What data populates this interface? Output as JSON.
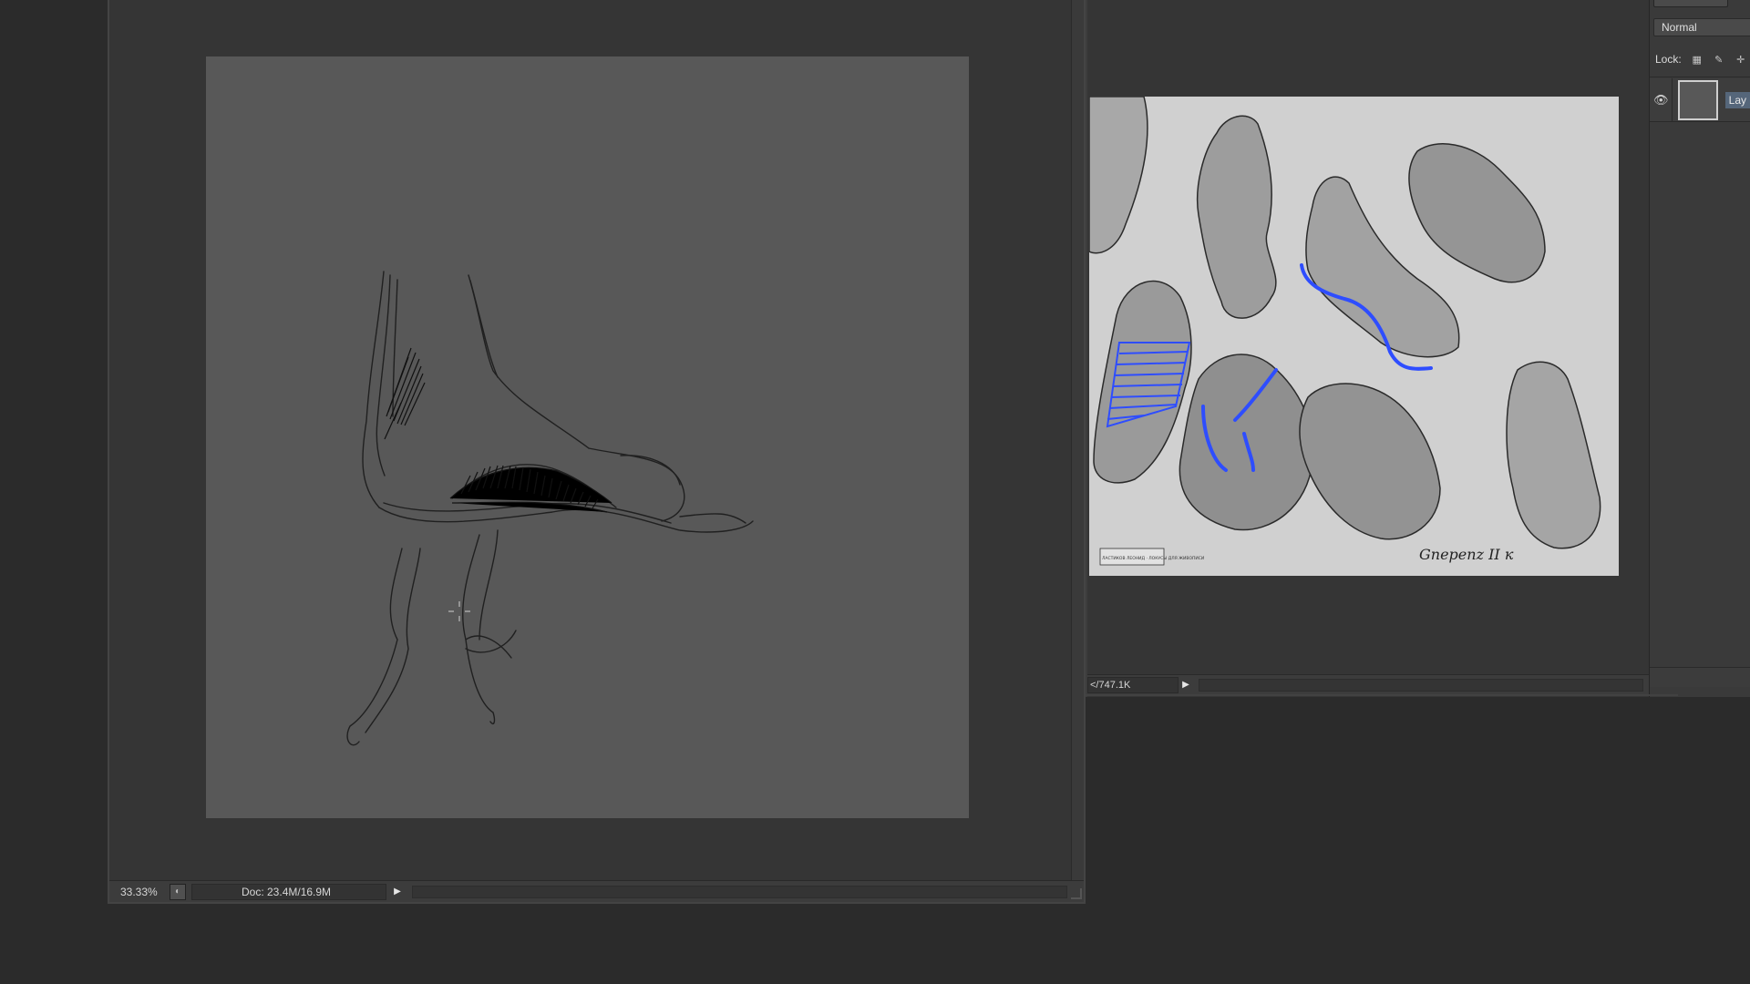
{
  "main_document": {
    "zoom": "33.33%",
    "doc_info": "Doc: 23.4M/16.9M",
    "canvas_color": "#585858"
  },
  "reference_window": {
    "doc_info": "</747.1K",
    "signature": "Gnepenz II к",
    "stamp_text": "ЛАСТИКОВ ЛЕОНИД · ЛОКУСЫ ДЛЯ ЖИВОПИСИ"
  },
  "layers_panel": {
    "blend_mode": "Normal",
    "lock_label": "Lock:",
    "layer_name": "Lay"
  },
  "icons": [
    "eye-icon",
    "lock-transparent-icon",
    "lock-brush-icon",
    "lock-move-icon",
    "play-arrow-icon",
    "status-info-icon"
  ],
  "colors": {
    "workspace": "#2b2b2b",
    "panel": "#3a3a3a",
    "highlight_blue": "#2e4dff"
  }
}
